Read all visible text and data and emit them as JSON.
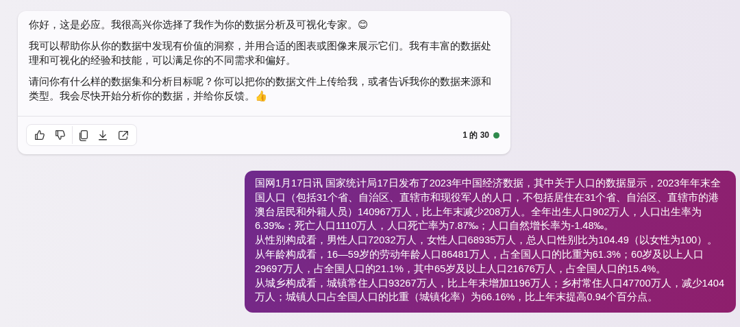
{
  "assistant_message": {
    "paragraphs": [
      "你好，这是必应。我很高兴你选择了我作为你的数据分析及可视化专家。😊",
      "我可以帮助你从你的数据中发现有价值的洞察，并用合适的图表或图像来展示它们。我有丰富的数据处理和可视化的经验和技能，可以满足你的不同需求和偏好。",
      "请问你有什么样的数据集和分析目标呢？你可以把你的数据文件上传给我，或者告诉我你的数据来源和类型。我会尽快开始分析你的数据，并给你反馈。👍"
    ],
    "actions": [
      {
        "kind": "like"
      },
      {
        "kind": "dislike"
      },
      {
        "kind": "copy"
      },
      {
        "kind": "download"
      },
      {
        "kind": "share"
      }
    ],
    "counter": "1 的 30"
  },
  "user_message": {
    "paragraphs": [
      "国网1月17日讯 国家统计局17日发布了2023年中国经济数据，其中关于人口的数据显示，2023年年末全国人口（包括31个省、自治区、直辖市和现役军人的人口，不包括居住在31个省、自治区、直辖市的港澳台居民和外籍人员）140967万人，比上年末减少208万人。全年出生人口902万人，人口出生率为6.39‰；死亡人口1110万人，人口死亡率为7.87‰；人口自然增长率为-1.48‰。",
      "从性别构成看，男性人口72032万人，女性人口68935万人，总人口性别比为104.49（以女性为100）。",
      "从年龄构成看，16—59岁的劳动年龄人口86481万人，占全国人口的比重为61.3%；60岁及以上人口29697万人，占全国人口的21.1%，其中65岁及以上人口21676万人，占全国人口的15.4%。",
      "从城乡构成看，城镇常住人口93267万人，比上年末增加1196万人；乡村常住人口47700万人，减少1404万人；城镇人口占全国人口的比重（城镇化率）为66.16%，比上年末提高0.94个百分点。"
    ]
  }
}
